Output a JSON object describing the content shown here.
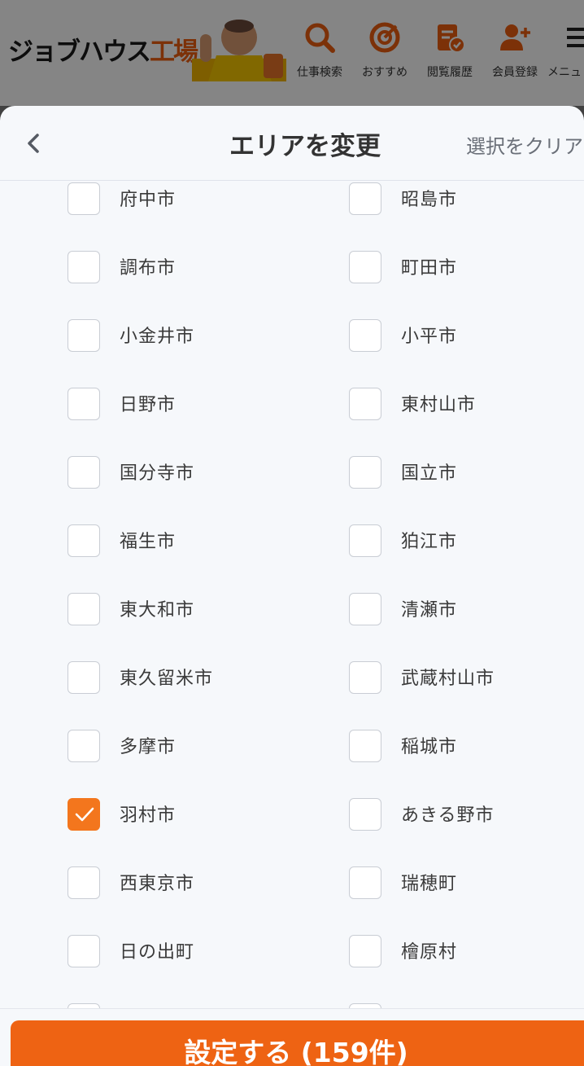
{
  "header": {
    "logo_main": "ジョブハウス",
    "logo_accent": "工場",
    "nav": [
      {
        "label": "仕事検索",
        "icon": "search-icon"
      },
      {
        "label": "おすすめ",
        "icon": "target-icon"
      },
      {
        "label": "閲覧履歴",
        "icon": "history-icon"
      },
      {
        "label": "会員登録",
        "icon": "add-user-icon"
      },
      {
        "label": "メニュ",
        "icon": "menu-icon"
      }
    ]
  },
  "modal": {
    "title": "エリアを変更",
    "clear_label": "選択をクリア",
    "back_icon": "chevron-left-icon"
  },
  "areas": [
    {
      "label": "府中市",
      "checked": false
    },
    {
      "label": "昭島市",
      "checked": false
    },
    {
      "label": "調布市",
      "checked": false
    },
    {
      "label": "町田市",
      "checked": false
    },
    {
      "label": "小金井市",
      "checked": false
    },
    {
      "label": "小平市",
      "checked": false
    },
    {
      "label": "日野市",
      "checked": false
    },
    {
      "label": "東村山市",
      "checked": false
    },
    {
      "label": "国分寺市",
      "checked": false
    },
    {
      "label": "国立市",
      "checked": false
    },
    {
      "label": "福生市",
      "checked": false
    },
    {
      "label": "狛江市",
      "checked": false
    },
    {
      "label": "東大和市",
      "checked": false
    },
    {
      "label": "清瀬市",
      "checked": false
    },
    {
      "label": "東久留米市",
      "checked": false
    },
    {
      "label": "武蔵村山市",
      "checked": false
    },
    {
      "label": "多摩市",
      "checked": false
    },
    {
      "label": "稲城市",
      "checked": false
    },
    {
      "label": "羽村市",
      "checked": true
    },
    {
      "label": "あきる野市",
      "checked": false
    },
    {
      "label": "西東京市",
      "checked": false
    },
    {
      "label": "瑞穂町",
      "checked": false
    },
    {
      "label": "日の出町",
      "checked": false
    },
    {
      "label": "檜原村",
      "checked": false
    }
  ],
  "footer": {
    "submit_label": "設定する (159件)"
  },
  "colors": {
    "accent": "#ee6313",
    "checked": "#f3761d",
    "logo_accent": "#ee5f10"
  }
}
